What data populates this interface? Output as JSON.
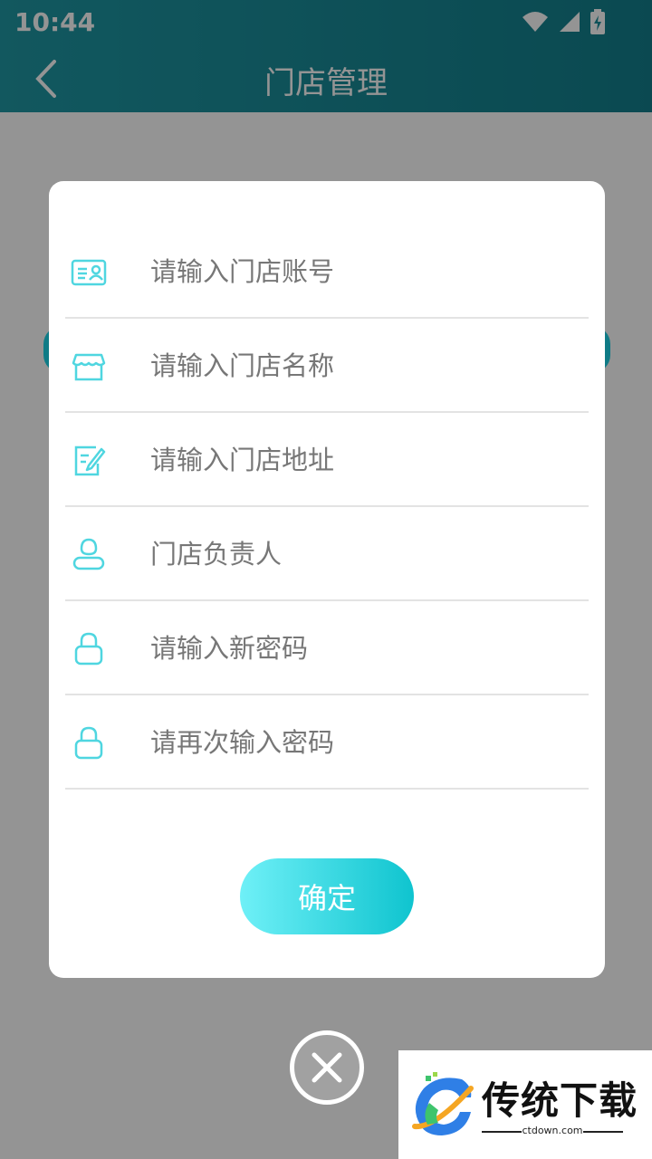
{
  "status_bar": {
    "time": "10:44"
  },
  "header": {
    "title": "门店管理"
  },
  "dialog": {
    "fields": [
      {
        "placeholder": "请输入门店账号",
        "icon": "id-card-icon"
      },
      {
        "placeholder": "请输入门店名称",
        "icon": "store-icon"
      },
      {
        "placeholder": "请输入门店地址",
        "icon": "edit-note-icon"
      },
      {
        "placeholder": "门店负责人",
        "icon": "person-icon"
      },
      {
        "placeholder": "请输入新密码",
        "icon": "lock-icon"
      },
      {
        "placeholder": "请再次输入密码",
        "icon": "lock-icon"
      }
    ],
    "confirm_label": "确定"
  },
  "watermark": {
    "brand": "传统下载",
    "domain": "ctdown.com"
  },
  "colors": {
    "header": "#1f98a4",
    "accent": "#1fc9d4",
    "icon": "#4fd6e0"
  }
}
